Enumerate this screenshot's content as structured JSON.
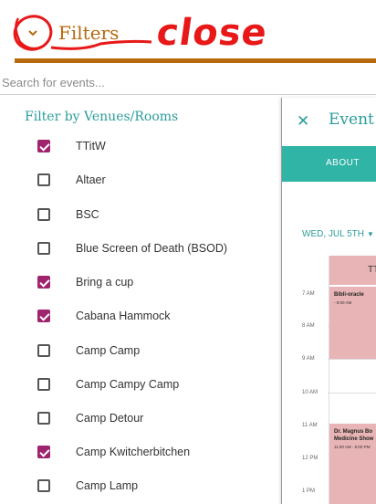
{
  "header": {
    "title": "Filters",
    "annotation": "close"
  },
  "search": {
    "placeholder": "Search for events..."
  },
  "filter": {
    "section_title": "Filter by Venues/Rooms",
    "venues": [
      {
        "label": "TTitW",
        "checked": true
      },
      {
        "label": "Altaer",
        "checked": false
      },
      {
        "label": "BSC",
        "checked": false
      },
      {
        "label": "Blue Screen of Death (BSOD)",
        "checked": false
      },
      {
        "label": "Bring a cup",
        "checked": true
      },
      {
        "label": "Cabana Hammock",
        "checked": true
      },
      {
        "label": "Camp Camp",
        "checked": false
      },
      {
        "label": "Camp Campy Camp",
        "checked": false
      },
      {
        "label": "Camp Detour",
        "checked": false
      },
      {
        "label": "Camp Kwitcherbitchen",
        "checked": true
      },
      {
        "label": "Camp Lamp",
        "checked": false
      }
    ]
  },
  "event_panel": {
    "close_icon": "close-icon",
    "title": "Event I",
    "tab_about": "ABOUT",
    "date": "WED, JUL 5TH",
    "column_header": "TT",
    "times": [
      "7 AM",
      "8 AM",
      "9 AM",
      "10 AM",
      "11 AM",
      "12 PM",
      "1 PM"
    ],
    "events": [
      {
        "title": "Bibli-oracle",
        "time": "- 9:00 AM"
      },
      {
        "title": "Dr. Magnus Bo",
        "title2": "Medicine Show",
        "time": "11:00 AM - 6:00 PM"
      }
    ]
  },
  "colors": {
    "accent": "#2a9d9a",
    "brand": "#b8690e",
    "checkbox": "#a0236e",
    "event_block": "#e8b4b5",
    "annotation": "#e81818"
  }
}
